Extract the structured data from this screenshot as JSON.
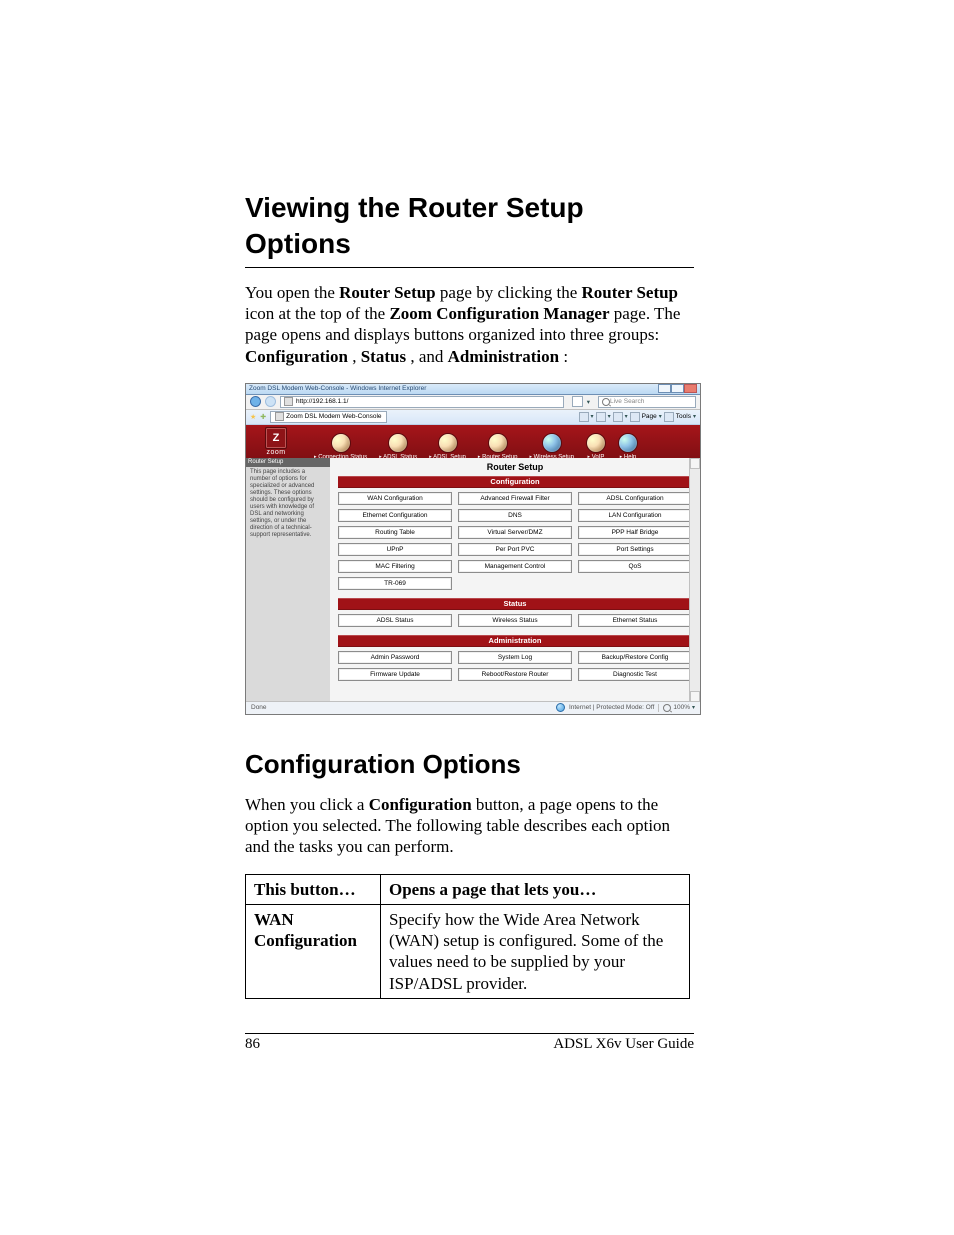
{
  "headings": {
    "h1": "Viewing the Router Setup Options",
    "h2": "Configuration Options"
  },
  "paragraphs": {
    "intro_pre1": "You open the ",
    "intro_b1": "Router Setup",
    "intro_mid1": " page by clicking the ",
    "intro_b2": "Router Setup",
    "intro_mid2": " icon at the top of the ",
    "intro_b3": "Zoom Configuration Manager",
    "intro_mid3": " page. The page opens and displays buttons organized into three groups: ",
    "intro_b4": "Configuration",
    "intro_sep1": ", ",
    "intro_b5": "Status",
    "intro_sep2": ", and ",
    "intro_b6": "Administration",
    "intro_end": ":",
    "config_pre": "When you click a ",
    "config_b1": "Configuration",
    "config_post": " button, a page opens to the option you selected. The following table describes each option and the tasks you can perform."
  },
  "screenshot": {
    "window_title": "Zoom DSL Modem Web-Console - Windows Internet Explorer",
    "address_url": "http://192.168.1.1/",
    "search_placeholder": "Live Search",
    "tab_title": "Zoom DSL Modem Web-Console",
    "ie_tools": {
      "page": "Page",
      "tools": "Tools"
    },
    "brand": "zoom",
    "nav": [
      "Connection Status",
      "ADSL Status",
      "ADSL Setup",
      "Router Setup",
      "Wireless Setup",
      "VoIP",
      "Help"
    ],
    "page_title": "Router Setup",
    "sidebar": {
      "title": "Router Setup",
      "text": "This page includes a number of options for specialized or advanced settings. These options should be configured by users with knowledge of DSL and networking settings, or under the direction of a technical-support representative."
    },
    "sections": {
      "configuration_label": "Configuration",
      "status_label": "Status",
      "administration_label": "Administration"
    },
    "configuration_buttons": [
      "WAN Configuration",
      "Advanced Firewall Filter",
      "ADSL Configuration",
      "Ethernet Configuration",
      "DNS",
      "LAN Configuration",
      "Routing Table",
      "Virtual Server/DMZ",
      "PPP Half Bridge",
      "UPnP",
      "Per Port PVC",
      "Port Settings",
      "MAC Filtering",
      "Management Control",
      "QoS",
      "TR-069"
    ],
    "status_buttons": [
      "ADSL Status",
      "Wireless Status",
      "Ethernet Status"
    ],
    "administration_buttons": [
      "Admin Password",
      "System Log",
      "Backup/Restore Config",
      "Firmware Update",
      "Reboot/Restore Router",
      "Diagnostic Test"
    ],
    "statusbar": {
      "left": "Done",
      "right": "Internet | Protected Mode: Off",
      "zoom": "100%"
    }
  },
  "table": {
    "head": {
      "col1": "This button…",
      "col2": "Opens a page that lets you…"
    },
    "rows": [
      {
        "label": "WAN Configuration",
        "desc": "Specify how the Wide Area Network (WAN) setup is configured. Some of the values need to be supplied by your ISP/ADSL provider."
      }
    ]
  },
  "footer": {
    "page": "86",
    "guide": "ADSL X6v User Guide"
  }
}
